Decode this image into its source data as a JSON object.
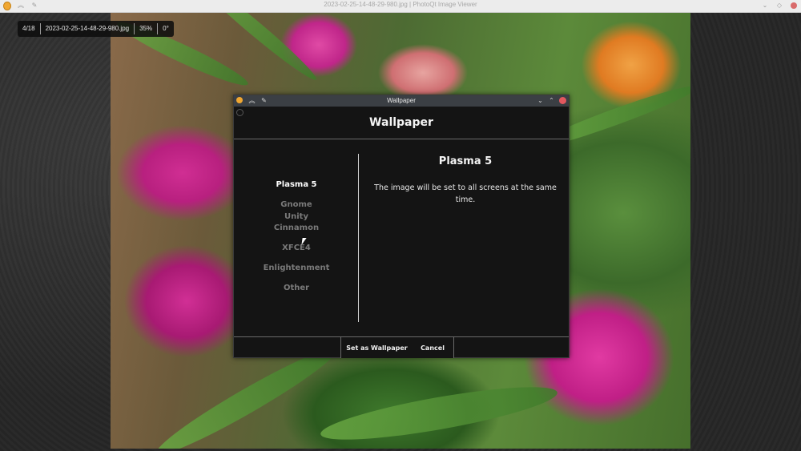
{
  "window": {
    "title": "2023-02-25-14-48-29-980.jpg | PhotoQt Image Viewer"
  },
  "info_bar": {
    "position": "4/18",
    "filename": "2023-02-25-14-48-29-980.jpg",
    "zoom": "35%",
    "rotation": "0°"
  },
  "dialog": {
    "window_title": "Wallpaper",
    "header": "Wallpaper",
    "options": [
      {
        "label": "Plasma 5",
        "active": true
      },
      {
        "label": "Gnome",
        "active": false
      },
      {
        "label": "Unity",
        "active": false
      },
      {
        "label": "Cinnamon",
        "active": false
      },
      {
        "label": "XFCE4",
        "active": false
      },
      {
        "label": "Enlightenment",
        "active": false
      },
      {
        "label": "Other",
        "active": false
      }
    ],
    "selected_title": "Plasma 5",
    "description": "The image will be set to all screens at the same time.",
    "buttons": {
      "set": "Set as Wallpaper",
      "cancel": "Cancel"
    }
  },
  "icons": {
    "app": "photoqt-logo-icon",
    "dialog_app": "photoqt-logo-icon",
    "keep_above": "chevrons-up-icon",
    "pin": "pin-icon",
    "minimize": "chevron-down-icon",
    "maximize": "chevron-up-icon",
    "close": "close-icon"
  },
  "colors": {
    "dialog_bg": "#141414",
    "dialog_titlebar": "#3b3f44",
    "active_text": "#ffffff",
    "inactive_text": "#7a7a7a",
    "close": "#e2585e"
  }
}
